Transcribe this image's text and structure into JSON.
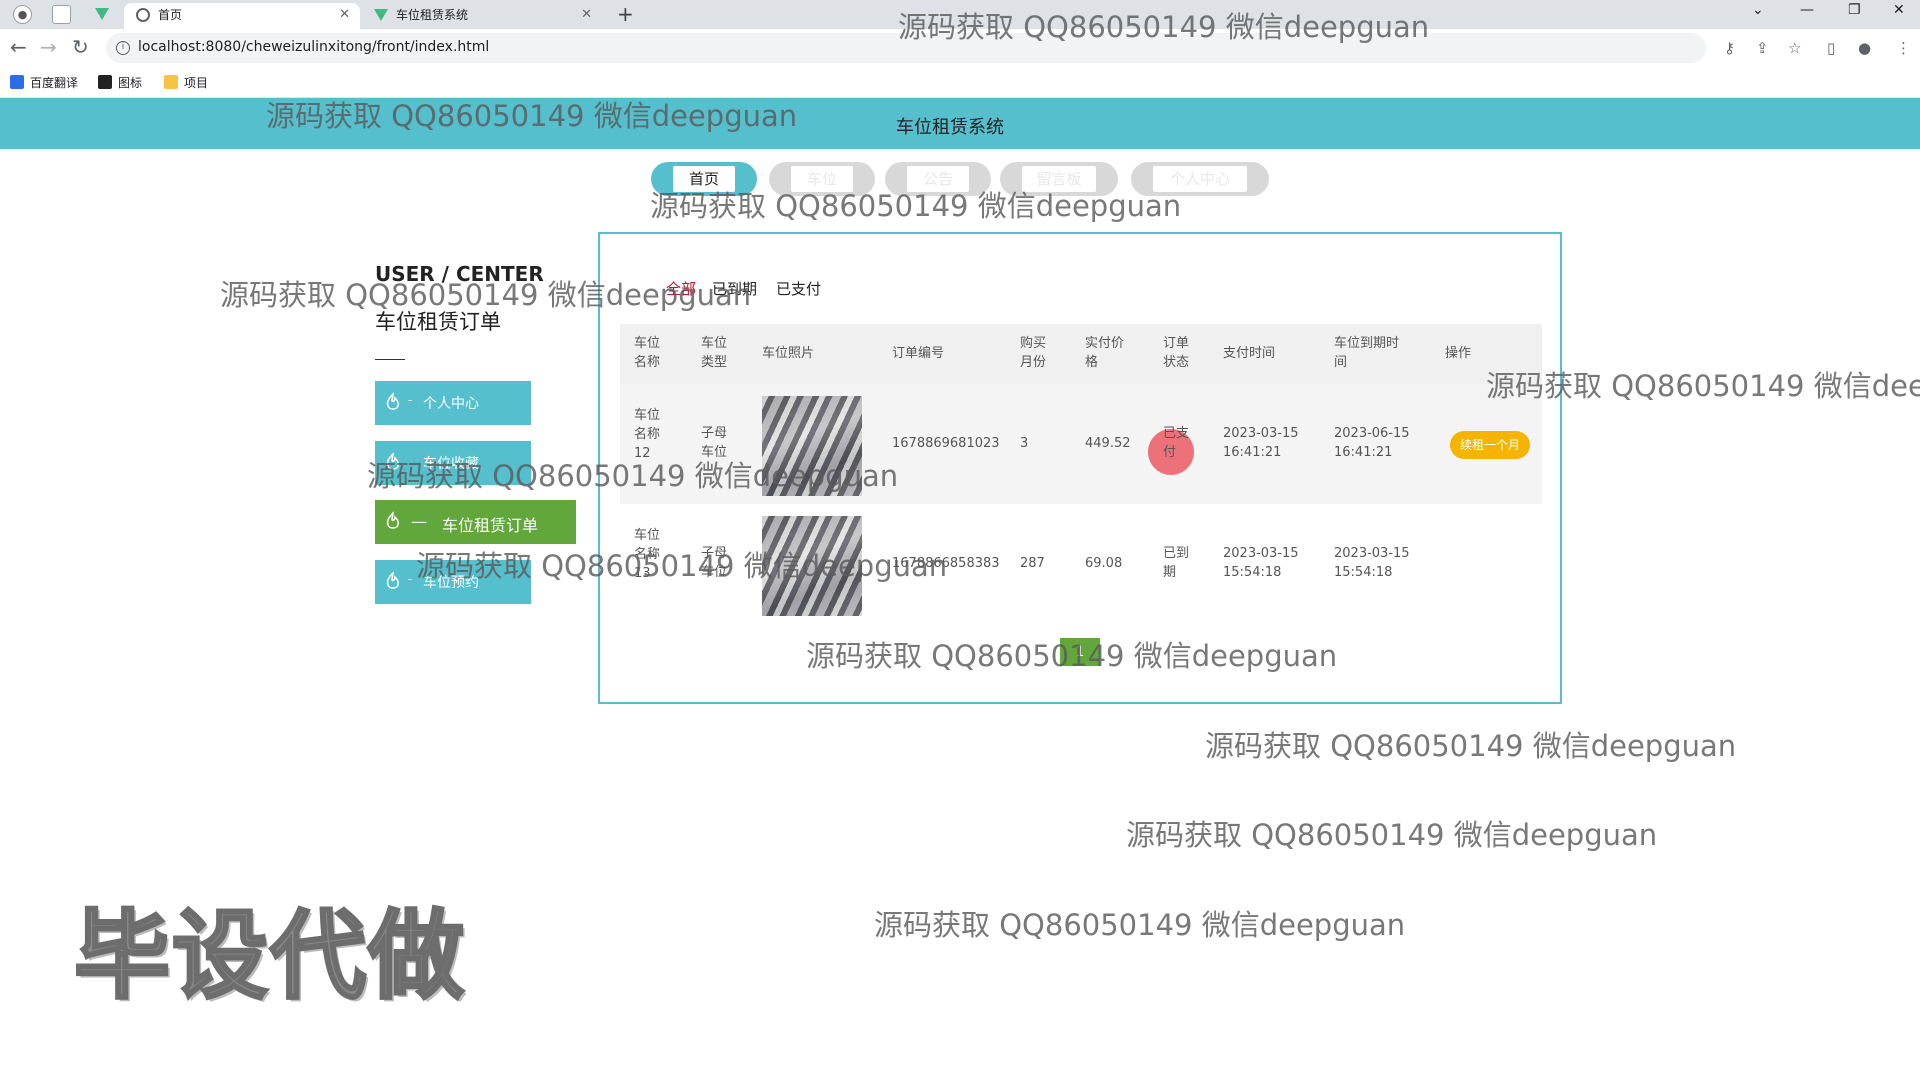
{
  "browser": {
    "tabs": [
      {
        "label": "首页",
        "active": true
      },
      {
        "label": "车位租赁系统",
        "active": false
      }
    ],
    "url": "localhost:8080/cheweizulinxitong/front/index.html",
    "bookmarks": [
      "百度翻译",
      "图标",
      "项目"
    ]
  },
  "site": {
    "title": "车位租赁系统",
    "nav": [
      "首页",
      "车位",
      "公告",
      "留言板",
      "个人中心"
    ]
  },
  "sidebar": {
    "heading_en": "USER / CENTER",
    "heading_cn": "车位租赁订单",
    "menu": [
      {
        "label": "个人中心",
        "active": false
      },
      {
        "label": "车位收藏",
        "active": false
      },
      {
        "label": "车位租赁订单",
        "active": true
      },
      {
        "label": "车位预约",
        "active": false
      }
    ]
  },
  "orders": {
    "filters": [
      "全部",
      "已到期",
      "已支付"
    ],
    "active_filter": "全部",
    "columns": [
      "车位名称",
      "车位类型",
      "车位照片",
      "订单编号",
      "购买月份",
      "实付价格",
      "订单状态",
      "支付时间",
      "车位到期时间",
      "操作"
    ],
    "rows": [
      {
        "name": "车位名称12",
        "type": "子母车位",
        "order_no": "1678869681023",
        "months": "3",
        "price": "449.52",
        "status": "已支付",
        "pay_time": "2023-03-15 16:41:21",
        "expire_time": "2023-06-15 16:41:21",
        "action": "续租一个月"
      },
      {
        "name": "车位名称13",
        "type": "子母车位",
        "order_no": "1678866858383",
        "months": "287",
        "price": "69.08",
        "status": "已到期",
        "pay_time": "2023-03-15 15:54:18",
        "expire_time": "2023-03-15 15:54:18",
        "action": ""
      }
    ],
    "page": "1"
  },
  "watermarks": {
    "text": "源码获取 QQ86050149 微信deepguan",
    "big": "毕设代做"
  },
  "colors": {
    "header": "#55bfce",
    "active_menu": "#62a73b",
    "action_button": "#f5b400",
    "active_filter": "#c8102e"
  }
}
